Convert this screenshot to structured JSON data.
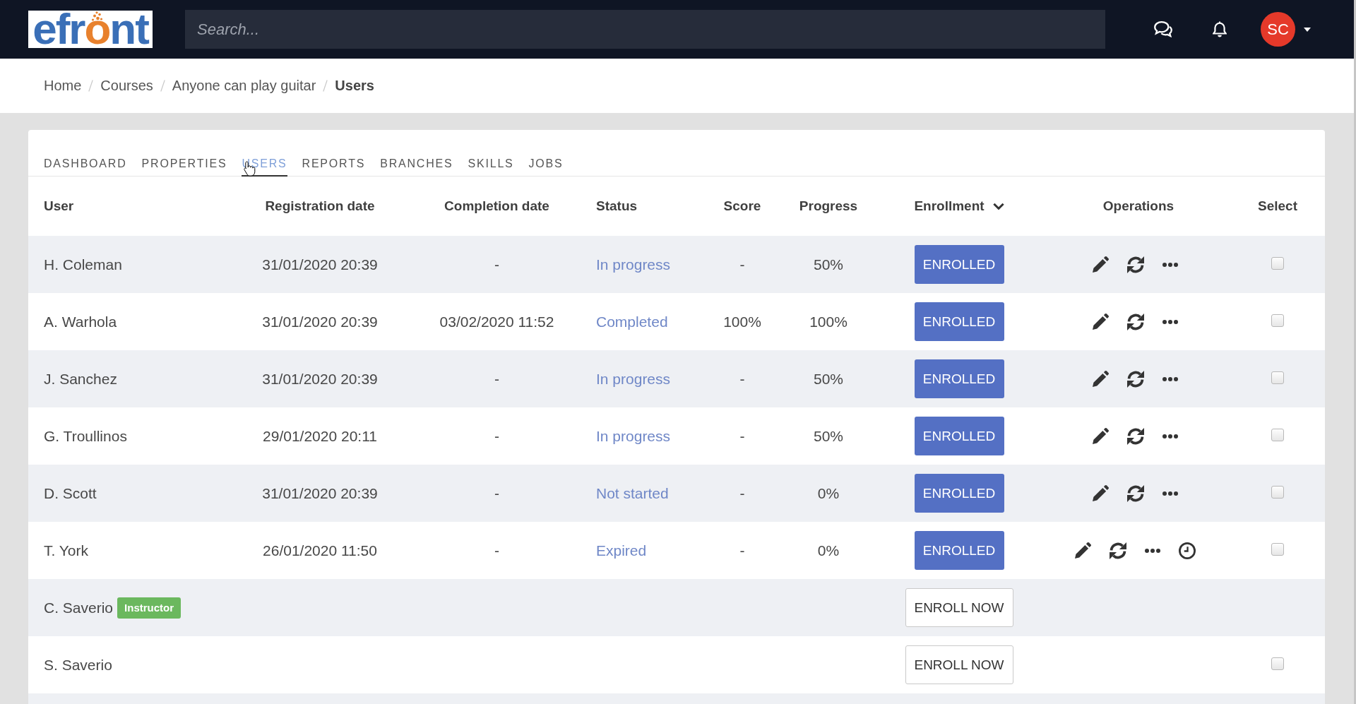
{
  "top_bar": {
    "logo": [
      {
        "text": "efr",
        "color": "#3a6fb7"
      },
      {
        "text": "o",
        "color": "#e8812d"
      },
      {
        "text": "nt",
        "color": "#3a6fb7"
      }
    ],
    "search": {
      "placeholder": "Search..."
    },
    "avatar": {
      "initials": "SC"
    }
  },
  "breadcrumb": [
    {
      "label": "Home",
      "current": false
    },
    {
      "label": "Courses",
      "current": false
    },
    {
      "label": "Anyone can play guitar",
      "current": false
    },
    {
      "label": "Users",
      "current": true
    }
  ],
  "tabs": [
    {
      "label": "DASHBOARD",
      "selected": false
    },
    {
      "label": "PROPERTIES",
      "selected": false
    },
    {
      "label": "USERS",
      "selected": true
    },
    {
      "label": "REPORTS",
      "selected": false
    },
    {
      "label": "BRANCHES",
      "selected": false
    },
    {
      "label": "SKILLS",
      "selected": false
    },
    {
      "label": "JOBS",
      "selected": false
    }
  ],
  "table": {
    "columns": [
      {
        "label": "User"
      },
      {
        "label": "Registration date"
      },
      {
        "label": "Completion date"
      },
      {
        "label": "Status"
      },
      {
        "label": "Score"
      },
      {
        "label": "Progress"
      },
      {
        "label": "Enrollment",
        "sorted_descending": true
      },
      {
        "label": "Operations"
      },
      {
        "label": "Select"
      }
    ],
    "rows": [
      {
        "user": "H. Coleman",
        "registration_date": "31/01/2020 20:39",
        "completion_date": "-",
        "status": "In progress",
        "score": "-",
        "progress": "50%",
        "enrollment": {
          "label": "ENROLLED",
          "kind": "enrolled"
        },
        "operations": [
          {
            "kind": "edit"
          },
          {
            "kind": "reset"
          },
          {
            "kind": "more"
          }
        ],
        "selected": false
      },
      {
        "user": "A. Warhola",
        "registration_date": "31/01/2020 20:39",
        "completion_date": "03/02/2020 11:52",
        "status": "Completed",
        "score": "100%",
        "progress": "100%",
        "enrollment": {
          "label": "ENROLLED",
          "kind": "enrolled"
        },
        "operations": [
          {
            "kind": "edit"
          },
          {
            "kind": "reset"
          },
          {
            "kind": "more"
          }
        ],
        "selected": false
      },
      {
        "user": "J. Sanchez",
        "registration_date": "31/01/2020 20:39",
        "completion_date": "-",
        "status": "In progress",
        "score": "-",
        "progress": "50%",
        "enrollment": {
          "label": "ENROLLED",
          "kind": "enrolled"
        },
        "operations": [
          {
            "kind": "edit"
          },
          {
            "kind": "reset"
          },
          {
            "kind": "more"
          }
        ],
        "selected": false
      },
      {
        "user": "G. Troullinos",
        "registration_date": "29/01/2020 20:11",
        "completion_date": "-",
        "status": "In progress",
        "score": "-",
        "progress": "50%",
        "enrollment": {
          "label": "ENROLLED",
          "kind": "enrolled"
        },
        "operations": [
          {
            "kind": "edit"
          },
          {
            "kind": "reset"
          },
          {
            "kind": "more"
          }
        ],
        "selected": false
      },
      {
        "user": "D. Scott",
        "registration_date": "31/01/2020 20:39",
        "completion_date": "-",
        "status": "Not started",
        "score": "-",
        "progress": "0%",
        "enrollment": {
          "label": "ENROLLED",
          "kind": "enrolled"
        },
        "operations": [
          {
            "kind": "edit"
          },
          {
            "kind": "reset"
          },
          {
            "kind": "more"
          }
        ],
        "selected": false
      },
      {
        "user": "T. York",
        "registration_date": "26/01/2020 11:50",
        "completion_date": "-",
        "status": "Expired",
        "score": "-",
        "progress": "0%",
        "enrollment": {
          "label": "ENROLLED",
          "kind": "enrolled"
        },
        "operations": [
          {
            "kind": "edit"
          },
          {
            "kind": "reset"
          },
          {
            "kind": "more"
          },
          {
            "kind": "expiration"
          }
        ],
        "selected": false
      },
      {
        "user": "C. Saverio",
        "badge": "Instructor",
        "enrollment": {
          "label": "ENROLL NOW",
          "kind": "enroll"
        }
      },
      {
        "user": "S. Saverio",
        "enrollment": {
          "label": "ENROLL NOW",
          "kind": "enroll"
        },
        "selected": false
      }
    ]
  }
}
